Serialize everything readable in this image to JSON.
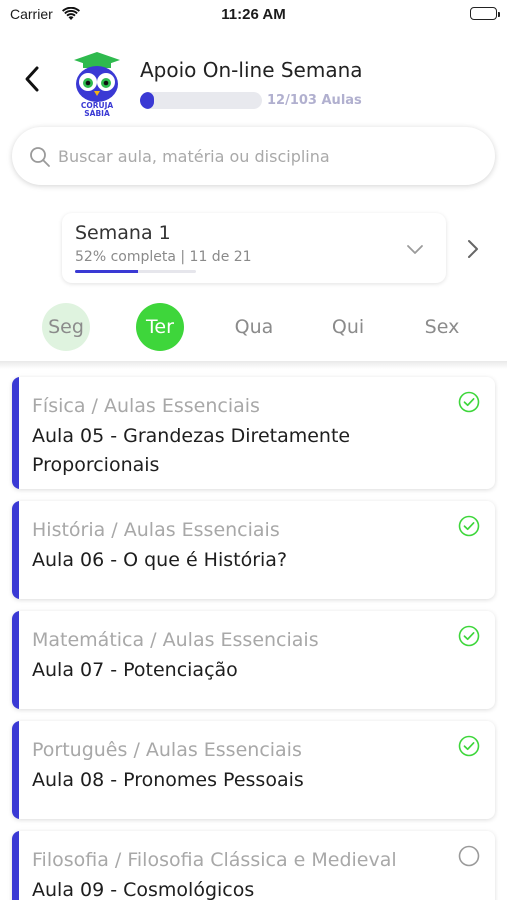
{
  "status_bar": {
    "carrier": "Carrier",
    "time": "11:26 AM"
  },
  "header": {
    "title": "Apoio On-line Semana",
    "progress_text": "12/103 Aulas",
    "progress_fraction": 0.117,
    "logo_text_line1": "CORUJA",
    "logo_text_line2": "SÁBIA"
  },
  "search": {
    "placeholder": "Buscar aula, matéria ou disciplina"
  },
  "week": {
    "title": "Semana 1",
    "subtitle": "52% completa | 11 de 21",
    "completion_fraction": 0.52
  },
  "days": [
    {
      "label": "Seg",
      "state": "past"
    },
    {
      "label": "Ter",
      "state": "active"
    },
    {
      "label": "Qua",
      "state": "default"
    },
    {
      "label": "Qui",
      "state": "default"
    },
    {
      "label": "Sex",
      "state": "default"
    }
  ],
  "lessons": [
    {
      "category": "Física / Aulas Essenciais",
      "name": "Aula 05 - Grandezas Diretamente Proporcionais",
      "done": true
    },
    {
      "category": "História / Aulas Essenciais",
      "name": "Aula 06 - O que é História?",
      "done": true
    },
    {
      "category": "Matemática / Aulas Essenciais",
      "name": "Aula 07 - Potenciação",
      "done": true
    },
    {
      "category": "Português / Aulas Essenciais",
      "name": "Aula 08 - Pronomes Pessoais",
      "done": true
    },
    {
      "category": "Filosofia / Filosofia Clássica e Medieval",
      "name": "Aula 09 - Cosmológicos",
      "done": false
    }
  ],
  "colors": {
    "accent": "#3a39d4",
    "active_day": "#3ed63b",
    "check": "#3ed63b"
  }
}
